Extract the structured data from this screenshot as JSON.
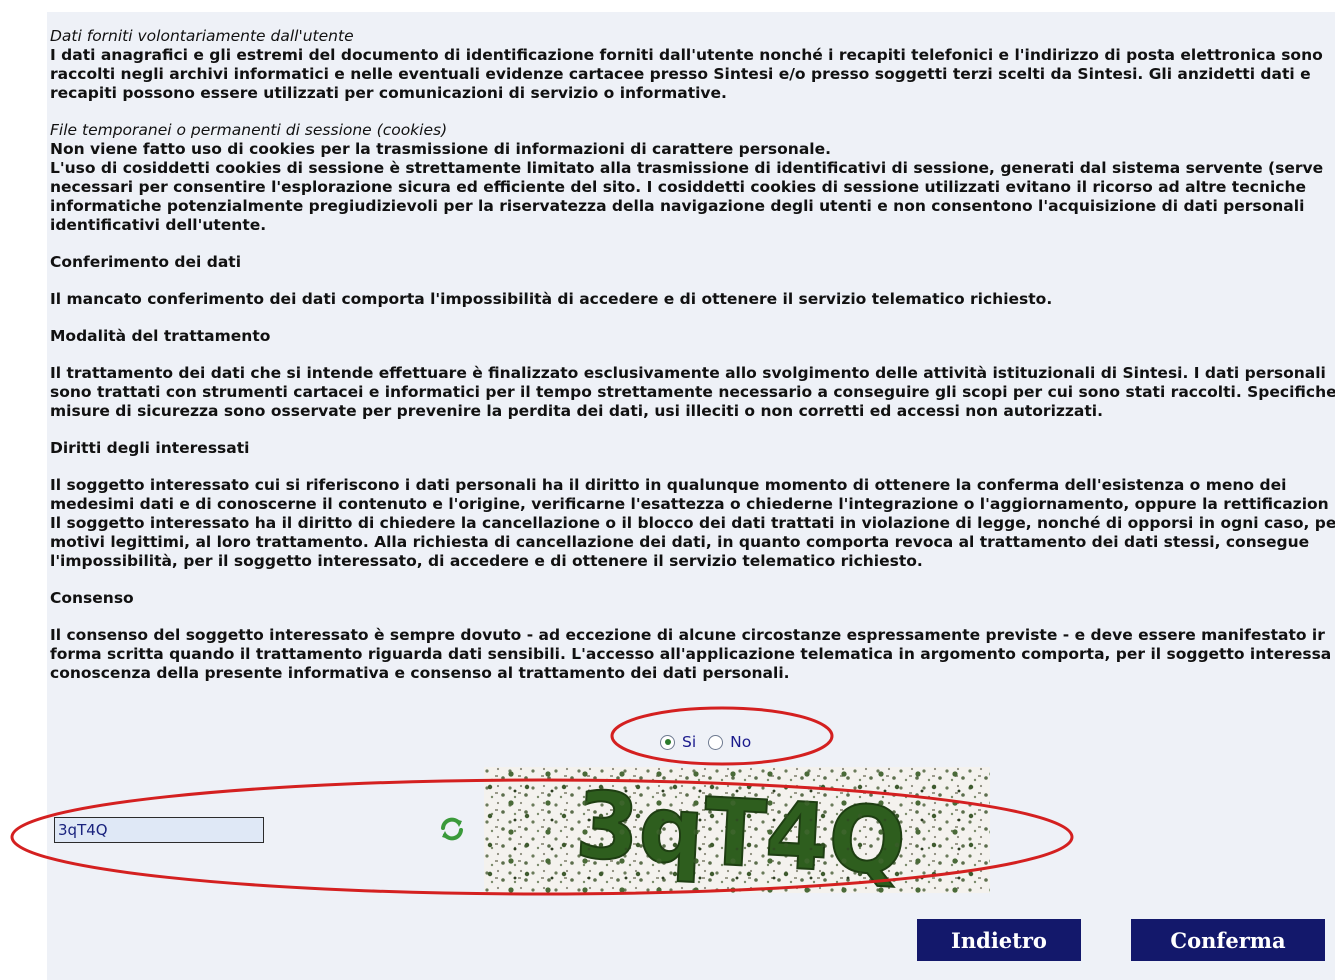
{
  "privacy": {
    "voluntary_title": "Dati forniti volontariamente dall'utente",
    "voluntary_lines": [
      "I dati anagrafici e gli estremi del documento di identificazione forniti dall'utente nonché i recapiti telefonici e l'indirizzo di posta elettronica sono",
      "raccolti negli archivi informatici e nelle eventuali evidenze cartacee presso Sintesi e/o presso soggetti terzi scelti da Sintesi. Gli anzidetti dati e",
      "recapiti possono essere utilizzati per comunicazioni di servizio o informative."
    ],
    "cookies_title": "File temporanei o permanenti di sessione (cookies)",
    "cookies_lines": [
      "Non viene fatto uso di cookies per la trasmissione di informazioni di carattere personale.",
      "L'uso di cosiddetti cookies di sessione è strettamente limitato alla trasmissione di identificativi di sessione, generati dal sistema servente (serve",
      "necessari per consentire l'esplorazione sicura ed efficiente del sito. I cosiddetti cookies di sessione utilizzati evitano il ricorso ad altre tecniche",
      "informatiche potenzialmente pregiudizievoli per la riservatezza della navigazione degli utenti e non consentono l'acquisizione di dati personali",
      "identificativi dell'utente."
    ],
    "conferimento_title": "Conferimento dei dati",
    "conferimento_text": "Il mancato conferimento dei dati comporta l'impossibilità di accedere e di ottenere il servizio telematico richiesto.",
    "modalita_title": "Modalità del trattamento",
    "modalita_lines": [
      "Il trattamento dei dati che si intende effettuare è finalizzato esclusivamente allo svolgimento delle attività istituzionali di Sintesi. I dati personali",
      "sono trattati con strumenti cartacei e informatici per il tempo strettamente necessario a conseguire gli scopi per cui sono stati raccolti. Specifiche",
      "misure di sicurezza sono osservate per prevenire la perdita dei dati, usi illeciti o non corretti ed accessi non autorizzati."
    ],
    "diritti_title": "Diritti degli interessati",
    "diritti_lines": [
      "Il soggetto interessato cui si riferiscono i dati personali ha il diritto in qualunque momento di ottenere la conferma dell'esistenza o meno dei",
      "medesimi dati e di conoscerne il contenuto e l'origine, verificarne l'esattezza o chiederne l'integrazione o l'aggiornamento, oppure la rettificazion",
      "Il soggetto interessato ha il diritto di chiedere la cancellazione o il blocco dei dati trattati in violazione di legge, nonché di opporsi in ogni caso, pe",
      "motivi legittimi, al loro trattamento. Alla richiesta di cancellazione dei dati, in quanto comporta revoca al trattamento dei dati stessi, consegue",
      "l'impossibilità, per il soggetto interessato, di accedere e di ottenere il servizio telematico richiesto."
    ],
    "consenso_title": "Consenso",
    "consenso_lines": [
      "Il consenso del soggetto interessato è sempre dovuto - ad eccezione di alcune circostanze espressamente previste - e deve essere manifestato ir",
      "forma scritta quando il trattamento riguarda dati sensibili. L'accesso all'applicazione telematica in argomento comporta, per il soggetto interessa",
      "conoscenza della presente informativa e consenso al trattamento dei dati personali."
    ]
  },
  "consent": {
    "yes_label": "Si",
    "no_label": "No",
    "selected": "Si"
  },
  "captcha": {
    "input_value": "3qT4Q",
    "image_text": "3qT4Q",
    "refresh_icon": "refresh-icon"
  },
  "buttons": {
    "back_label": "Indietro",
    "confirm_label": "Conferma"
  },
  "colors": {
    "button_bg": "#13186b",
    "panel_bg": "#eef1f7",
    "annotation": "#d42020",
    "captcha_text": "#2e5e1e"
  }
}
